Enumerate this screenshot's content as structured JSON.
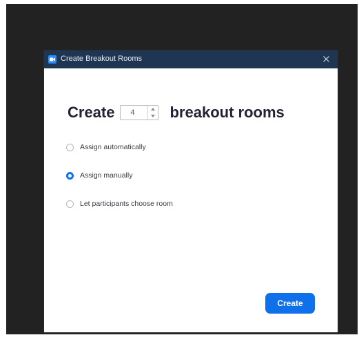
{
  "window": {
    "title": "Create Breakout Rooms",
    "app_icon": "zoom-camera-icon",
    "close_icon": "close-icon"
  },
  "headline": {
    "prefix": "Create",
    "room_count": "4",
    "suffix": "breakout rooms"
  },
  "assignment_options": [
    {
      "label": "Assign automatically",
      "selected": false
    },
    {
      "label": "Assign manually",
      "selected": true
    },
    {
      "label": "Let participants choose room",
      "selected": false
    }
  ],
  "footer": {
    "create_label": "Create"
  },
  "colors": {
    "titlebar": "#1f3653",
    "accent": "#0e71eb",
    "backdrop": "#222222"
  }
}
